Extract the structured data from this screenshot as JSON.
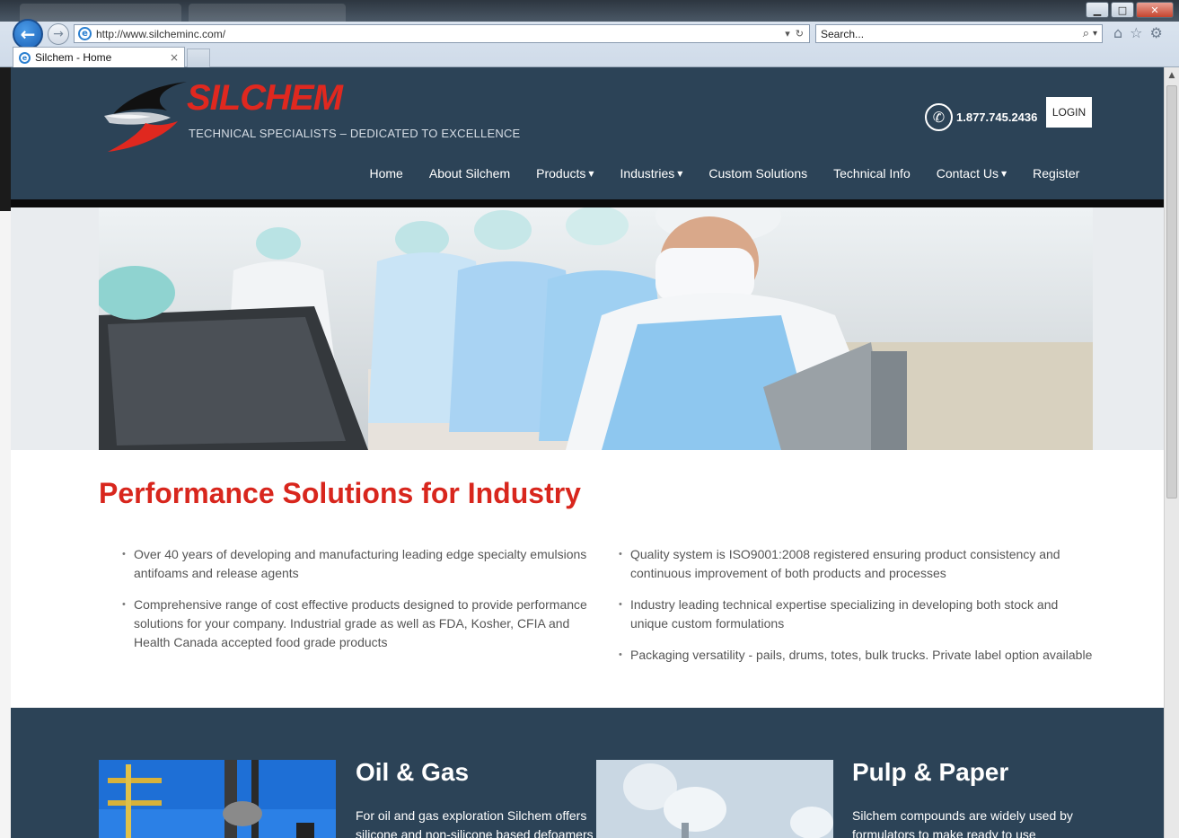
{
  "browser": {
    "address": "http://www.silcheminc.com/",
    "search_placeholder": "Search...",
    "tab_title": "Silchem - Home",
    "tab_close": "×",
    "back_glyph": "←",
    "forward_glyph": "→",
    "dropdown_glyph": "▾",
    "refresh_glyph": "↻",
    "search_glyph": "⌕",
    "home_glyph": "⌂",
    "star_glyph": "☆",
    "gear_glyph": "⚙",
    "minimize_glyph": "▁",
    "maximize_glyph": "□",
    "close_glyph": "✕",
    "scroll_up_glyph": "▲"
  },
  "header": {
    "brand": "SILCHEM",
    "tagline": "TECHNICAL SPECIALISTS – DEDICATED TO EXCELLENCE",
    "phone_glyph": "✆",
    "phone": "1.877.745.2436",
    "login": "LOGIN",
    "caret": "▼",
    "nav": [
      {
        "label": "Home"
      },
      {
        "label": "About Silchem"
      },
      {
        "label": "Products"
      },
      {
        "label": "Industries"
      },
      {
        "label": "Custom Solutions"
      },
      {
        "label": "Technical Info"
      },
      {
        "label": "Contact Us"
      },
      {
        "label": "Register"
      }
    ]
  },
  "intro": {
    "title": "Performance Solutions for Industry",
    "left_bullets": [
      "Over 40 years of developing and manufacturing leading edge specialty emulsions antifoams and release agents",
      "Comprehensive range of cost effective products designed to provide performance solutions for your company. Industrial grade as well as FDA, Kosher, CFIA and Health Canada accepted food grade products"
    ],
    "right_bullets": [
      "Quality system is ISO9001:2008 registered ensuring product consistency and continuous improvement of both products and processes",
      "Industry leading technical expertise specializing in developing both stock and unique custom formulations",
      "Packaging versatility - pails, drums, totes, bulk trucks. Private label option available"
    ]
  },
  "industries": [
    {
      "title": "Oil & Gas",
      "text": "For oil and gas exploration Silchem offers silicone and non-silicone based defoamers"
    },
    {
      "title": "Pulp & Paper",
      "text": "Silchem compounds are widely used by formulators to make ready to use"
    }
  ],
  "colors": {
    "accent_red": "#d8261d",
    "header_navy": "#2c4357"
  }
}
